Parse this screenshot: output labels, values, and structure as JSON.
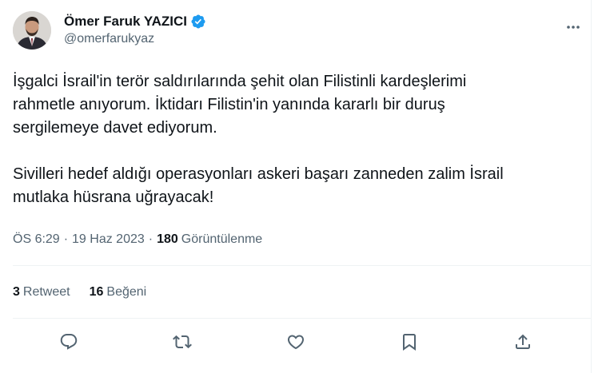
{
  "author": {
    "display_name": "Ömer Faruk YAZICI",
    "handle": "@omerfarukyaz",
    "verified": true,
    "avatar_icon": "profile-photo"
  },
  "tweet": {
    "text": "İşgalci İsrail'in terör saldırılarında şehit olan Filistinli kardeşlerimi\nrahmetle anıyorum. İktidarı Filistin'in yanında kararlı bir duruş\nsergilemeye davet ediyorum.\n\nSivilleri hedef aldığı operasyonları askeri başarı zanneden zalim İsrail\nmutlaka hüsrana uğrayacak!",
    "time": "ÖS 6:29",
    "separator": "·",
    "date": "19 Haz 2023",
    "views_count": "180",
    "views_label": "Görüntülenme"
  },
  "stats": {
    "retweets_count": "3",
    "retweets_label": "Retweet",
    "likes_count": "16",
    "likes_label": "Beğeni"
  },
  "actions": [
    "reply-icon",
    "retweet-icon",
    "like-icon",
    "bookmark-icon",
    "share-icon"
  ],
  "colors": {
    "verified_blue": "#1d9bf0",
    "secondary_text": "#536471",
    "primary_text": "#0f1419",
    "divider": "#eff3f4"
  }
}
